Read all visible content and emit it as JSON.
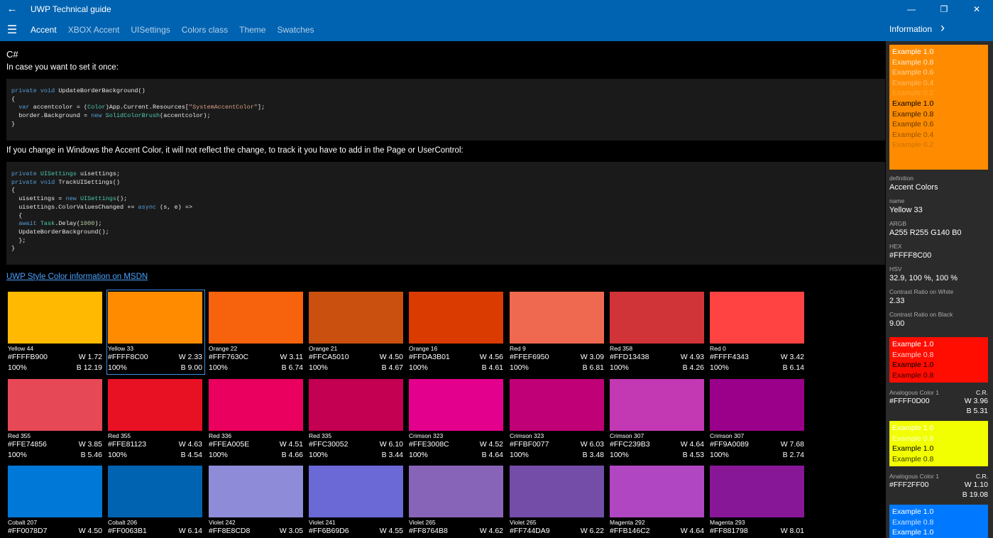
{
  "titlebar": {
    "back_glyph": "←",
    "app_title": "UWP Technical guide",
    "minimize_glyph": "—",
    "restore_glyph": "❐",
    "close_glyph": "✕"
  },
  "nav": {
    "hamburger_glyph": "☰",
    "tabs": [
      "Accent",
      "XBOX Accent",
      "UISettings",
      "Colors class",
      "Theme",
      "Swatches"
    ],
    "info_label": "Information",
    "info_chevron": "›"
  },
  "main": {
    "heading": "C#",
    "intro": "In case you want to set it once:",
    "paragraph2": "If you change in Windows the Accent Color, it will not reflect the change, to track it you have to add in the Page or UserControl:",
    "msdn_link": "UWP Style Color information on MSDN"
  },
  "colors": {
    "accent_bar": "#0063b1",
    "selected_outline": "#3b8be0",
    "link": "#4aa3ff"
  },
  "swatches": [
    {
      "name": "Yellow 44",
      "hex": "#FFFFB900",
      "color": "#FFB900",
      "pct": "100%",
      "w": "W 1.72",
      "b": "B 12.19"
    },
    {
      "name": "Yellow 33",
      "hex": "#FFFF8C00",
      "color": "#FF8C00",
      "pct": "100%",
      "w": "W 2.33",
      "b": "B 9.00",
      "selected": true
    },
    {
      "name": "Orange 22",
      "hex": "#FFF7630C",
      "color": "#F7630C",
      "pct": "100%",
      "w": "W 3.11",
      "b": "B 6.74"
    },
    {
      "name": "Orange 21",
      "hex": "#FFCA5010",
      "color": "#CA5010",
      "pct": "100%",
      "w": "W 4.50",
      "b": "B 4.67"
    },
    {
      "name": "Orange 16",
      "hex": "#FFDA3B01",
      "color": "#DA3B01",
      "pct": "100%",
      "w": "W 4.56",
      "b": "B 4.61"
    },
    {
      "name": "Red 9",
      "hex": "#FFEF6950",
      "color": "#EF6950",
      "pct": "100%",
      "w": "W 3.09",
      "b": "B 6.81"
    },
    {
      "name": "Red 358",
      "hex": "#FFD13438",
      "color": "#D13438",
      "pct": "100%",
      "w": "W 4.93",
      "b": "B 4.26"
    },
    {
      "name": "Red 0",
      "hex": "#FFFF4343",
      "color": "#FF4343",
      "pct": "100%",
      "w": "W 3.42",
      "b": "B 6.14"
    },
    {
      "name": "Red 355",
      "hex": "#FFE74856",
      "color": "#E74856",
      "pct": "100%",
      "w": "W 3.85",
      "b": "B 5.46"
    },
    {
      "name": "Red 355",
      "hex": "#FFE81123",
      "color": "#E81123",
      "pct": "100%",
      "w": "W 4.63",
      "b": "B 4.54"
    },
    {
      "name": "Red 336",
      "hex": "#FFEA005E",
      "color": "#EA005E",
      "pct": "100%",
      "w": "W 4.51",
      "b": "B 4.66"
    },
    {
      "name": "Red 335",
      "hex": "#FFC30052",
      "color": "#C30052",
      "pct": "100%",
      "w": "W 6.10",
      "b": "B 3.44"
    },
    {
      "name": "Crimson 323",
      "hex": "#FFE3008C",
      "color": "#E3008C",
      "pct": "100%",
      "w": "W 4.52",
      "b": "B 4.64"
    },
    {
      "name": "Crimson 323",
      "hex": "#FFBF0077",
      "color": "#BF0077",
      "pct": "100%",
      "w": "W 6.03",
      "b": "B 3.48"
    },
    {
      "name": "Crimson 307",
      "hex": "#FFC239B3",
      "color": "#C239B3",
      "pct": "100%",
      "w": "W 4.64",
      "b": "B 4.53"
    },
    {
      "name": "Crimson 307",
      "hex": "#FF9A0089",
      "color": "#9A0089",
      "pct": "100%",
      "w": "W 7.68",
      "b": "B 2.74"
    },
    {
      "name": "Cobalt 207",
      "hex": "#FF0078D7",
      "color": "#0078D7",
      "pct": "",
      "w": "W 4.50",
      "b": ""
    },
    {
      "name": "Cobalt 206",
      "hex": "#FF0063B1",
      "color": "#0063B1",
      "pct": "",
      "w": "W 6.14",
      "b": ""
    },
    {
      "name": "Violet 242",
      "hex": "#FF8E8CD8",
      "color": "#8E8CD8",
      "pct": "",
      "w": "W 3.05",
      "b": ""
    },
    {
      "name": "Violet 241",
      "hex": "#FF6B69D6",
      "color": "#6B69D6",
      "pct": "",
      "w": "W 4.55",
      "b": ""
    },
    {
      "name": "Violet 265",
      "hex": "#FF8764B8",
      "color": "#8764B8",
      "pct": "",
      "w": "W 4.62",
      "b": ""
    },
    {
      "name": "Violet 265",
      "hex": "#FF744DA9",
      "color": "#744DA9",
      "pct": "",
      "w": "W 6.22",
      "b": ""
    },
    {
      "name": "Magenta 292",
      "hex": "#FFB146C2",
      "color": "#B146C2",
      "pct": "",
      "w": "W 4.64",
      "b": ""
    },
    {
      "name": "Magenta 293",
      "hex": "#FF881798",
      "color": "#881798",
      "pct": "",
      "w": "W 8.01",
      "b": ""
    }
  ],
  "panel": {
    "preview_color": "#FF8C00",
    "preview_lines": [
      {
        "text": "Example 1.0",
        "color": "#ffffff",
        "opacity": 1.0
      },
      {
        "text": "Example 0.8",
        "color": "#ffffff",
        "opacity": 0.8
      },
      {
        "text": "Example 0.6",
        "color": "#ffffff",
        "opacity": 0.6
      },
      {
        "text": "Example 0.4",
        "color": "#ffffff",
        "opacity": 0.4
      },
      {
        "text": "Example 0.2",
        "color": "#ffffff",
        "opacity": 0.2
      },
      {
        "text": "Example 1.0",
        "color": "#000000",
        "opacity": 1.0
      },
      {
        "text": "Example 0.8",
        "color": "#000000",
        "opacity": 0.8
      },
      {
        "text": "Example 0.6",
        "color": "#000000",
        "opacity": 0.6
      },
      {
        "text": "Example 0.4",
        "color": "#000000",
        "opacity": 0.4
      },
      {
        "text": "Example 0.2",
        "color": "#000000",
        "opacity": 0.2
      }
    ],
    "definition_label": "definition",
    "definition_value": "Accent Colors",
    "name_label": "name",
    "name_value": "Yellow 33",
    "argb_label": "ARGB",
    "argb_value": "A255 R255 G140 B0",
    "hex_label": "HEX",
    "hex_value": "#FFFF8C00",
    "hsv_label": "HSV",
    "hsv_value": "32.9, 100 %, 100 %",
    "crw_label": "Contrast Ratio on White",
    "crw_value": "2.33",
    "crb_label": "Contrast Ratio on Black",
    "crb_value": "9.00",
    "analogous": [
      {
        "color": "#FF0D00",
        "lines": [
          {
            "text": "Example 1.0",
            "color": "#ffffff",
            "opacity": 1.0
          },
          {
            "text": "Example 0.8",
            "color": "#ffffff",
            "opacity": 0.8
          },
          {
            "text": "Example 1.0",
            "color": "#000000",
            "opacity": 1.0
          },
          {
            "text": "Example 0.8",
            "color": "#000000",
            "opacity": 0.8
          }
        ],
        "label": "Analogous Color 1",
        "cr_label": "C.R.",
        "hex": "#FFFF0D00",
        "w": "W 3.96",
        "b": "B 5.31"
      },
      {
        "color": "#F2FF00",
        "lines": [
          {
            "text": "Example 1.0",
            "color": "#ffffff",
            "opacity": 1.0
          },
          {
            "text": "Example 0.8",
            "color": "#ffffff",
            "opacity": 0.8
          },
          {
            "text": "Example 1.0",
            "color": "#000000",
            "opacity": 1.0
          },
          {
            "text": "Example 0.8",
            "color": "#000000",
            "opacity": 0.8
          }
        ],
        "label": "Analogous Color 1",
        "cr_label": "C.R.",
        "hex": "#FFF2FF00",
        "w": "W 1.10",
        "b": "B 19.08"
      },
      {
        "color": "#0078FF",
        "lines": [
          {
            "text": "Example 1.0",
            "color": "#ffffff",
            "opacity": 1.0
          },
          {
            "text": "Example 0.8",
            "color": "#ffffff",
            "opacity": 0.8
          },
          {
            "text": "Example 1.0",
            "color": "#ffffff",
            "opacity": 1.0
          }
        ]
      }
    ]
  }
}
